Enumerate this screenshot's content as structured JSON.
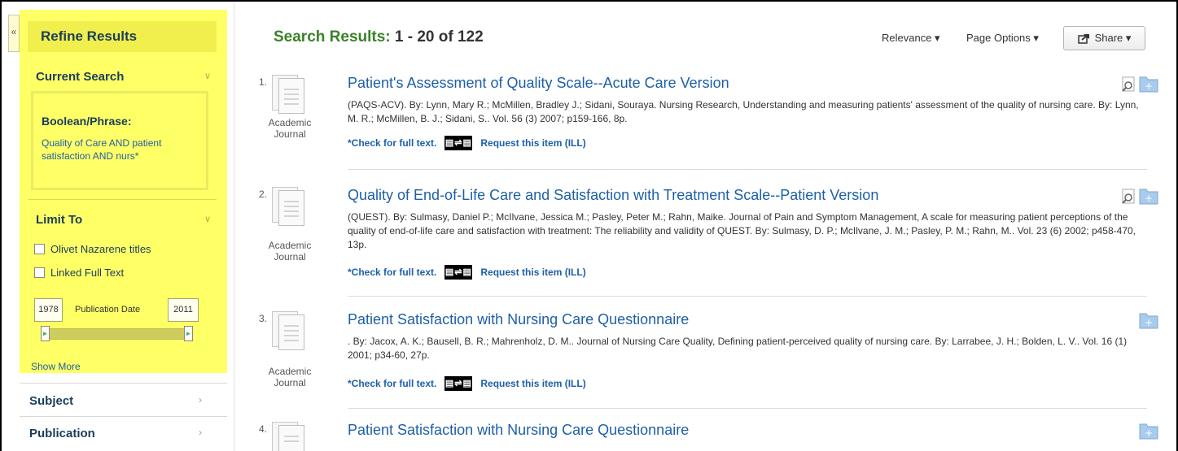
{
  "sidebar": {
    "collapse_glyph": "«",
    "refine_title": "Refine Results",
    "current_search": {
      "heading": "Current Search",
      "mode": "Boolean/Phrase:",
      "query": "Quality of Care AND patient satisfaction AND nurs*"
    },
    "limit_to": {
      "heading": "Limit To",
      "options": [
        {
          "label": "Olivet Nazarene titles",
          "checked": false
        },
        {
          "label": "Linked Full Text",
          "checked": false
        }
      ],
      "date_from": "1978",
      "date_label": "Publication Date",
      "date_to": "2011",
      "show_more": "Show More"
    },
    "facets": [
      {
        "label": "Subject"
      },
      {
        "label": "Publication"
      }
    ],
    "highlight_color": "#ffff66"
  },
  "header": {
    "results_label": "Search Results:",
    "results_range": "1 - 20 of 122",
    "relevance": "Relevance ▾",
    "page_options": "Page Options ▾",
    "share": "Share ▾"
  },
  "results": [
    {
      "num": "1.",
      "title": "Patient's Assessment of Quality Scale--Acute Care Version",
      "desc": "(PAQS-ACV). By: Lynn, Mary R.; McMillen, Bradley J.; Sidani, Souraya. Nursing Research, Understanding and measuring patients' assessment of the quality of nursing care. By: Lynn, M. R.; McMillen, B. J.; Sidani, S.. Vol. 56 (3) 2007; p159-166, 8p.",
      "type": "Academic Journal",
      "check": "*Check for full text.",
      "request": "Request this item (ILL)",
      "has_preview": true
    },
    {
      "num": "2.",
      "title": "Quality of End-of-Life Care and Satisfaction with Treatment Scale--Patient Version",
      "desc": "(QUEST). By: Sulmasy, Daniel P.; McIlvane, Jessica M.; Pasley, Peter M.; Rahn, Maike. Journal of Pain and Symptom Management, A scale for measuring patient perceptions of the quality of end-of-life care and satisfaction with treatment: The reliability and validity of QUEST. By: Sulmasy, D. P.; McIlvane, J. M.; Pasley, P. M.; Rahn, M.. Vol. 23 (6) 2002; p458-470, 13p.",
      "type": "Academic Journal",
      "check": "*Check for full text.",
      "request": "Request this item (ILL)",
      "has_preview": true
    },
    {
      "num": "3.",
      "title": "Patient Satisfaction with Nursing Care Questionnaire",
      "desc": ". By: Jacox, A. K.; Bausell, B. R.; Mahrenholz, D. M.. Journal of Nursing Care Quality, Defining patient-perceived quality of nursing care. By: Larrabee, J. H.; Bolden, L. V.. Vol. 16 (1) 2001; p34-60, 27p.",
      "type": "Academic Journal",
      "check": "*Check for full text.",
      "request": "Request this item (ILL)",
      "has_preview": false
    },
    {
      "num": "4.",
      "title": "Patient Satisfaction with Nursing Care Questionnaire",
      "desc": "",
      "type": "",
      "check": "",
      "request": "",
      "has_preview": false
    }
  ]
}
